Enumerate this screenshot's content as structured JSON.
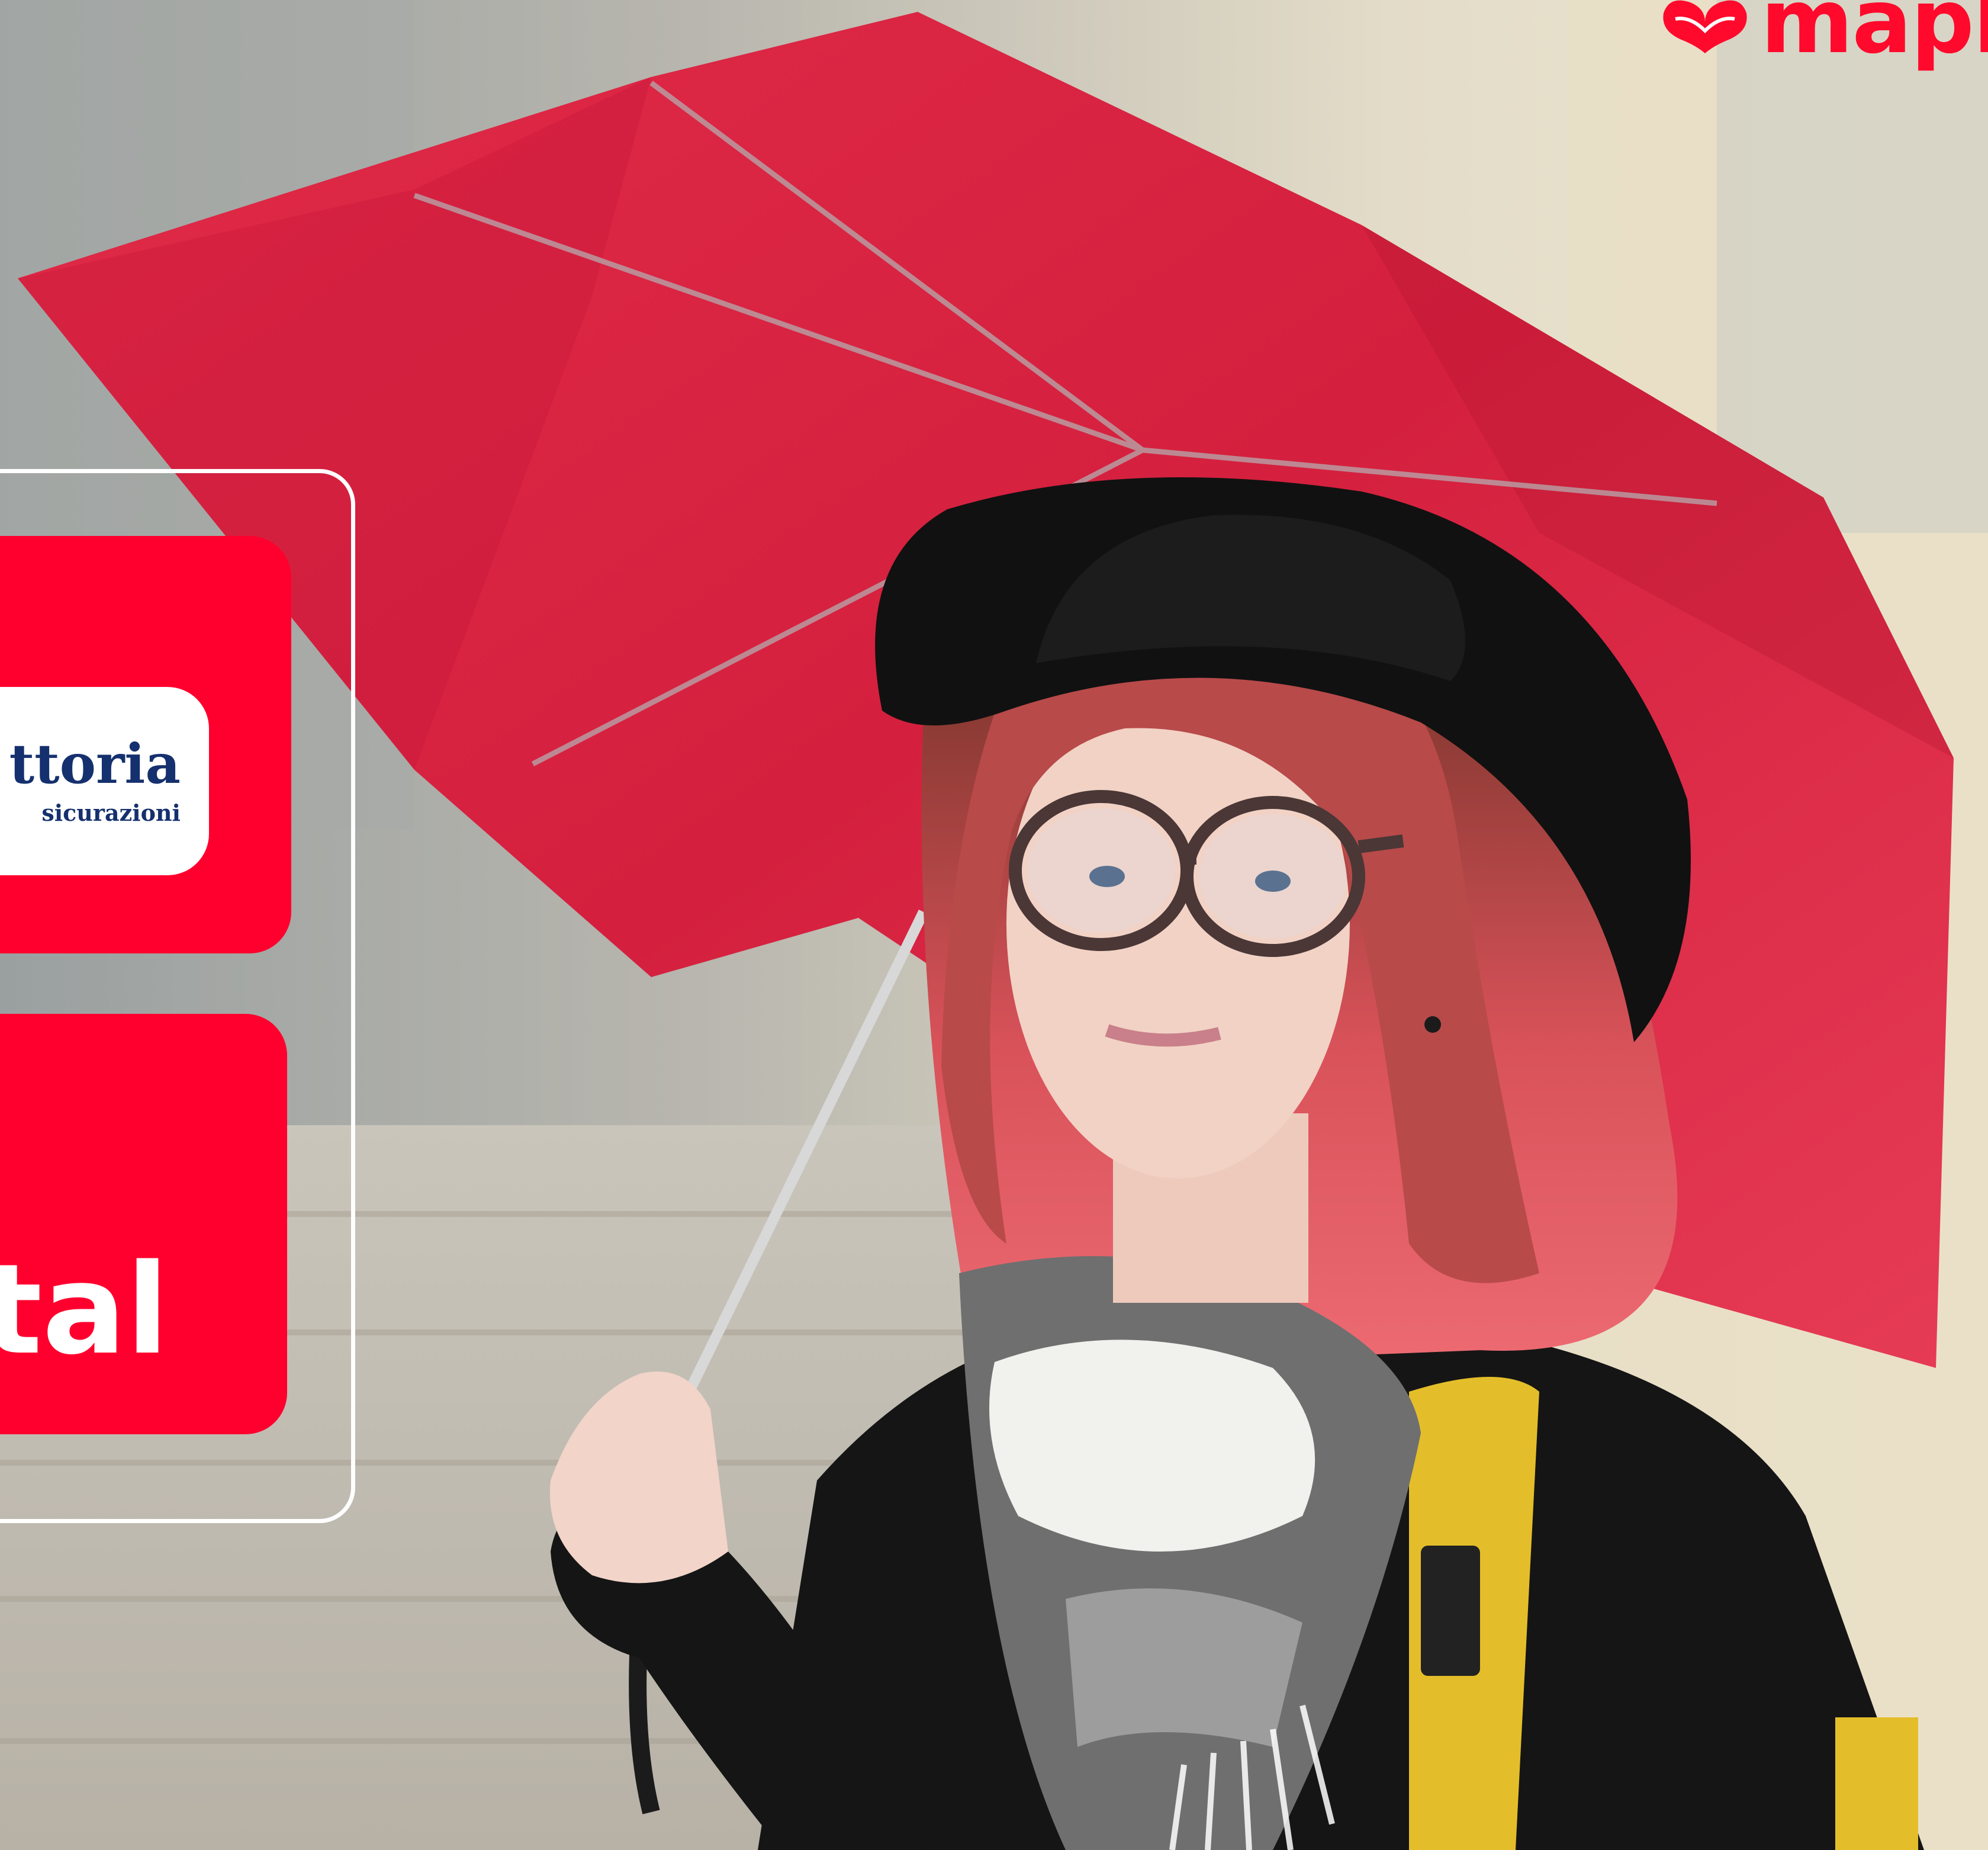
{
  "colors": {
    "brand_red": "#ff0a2c",
    "card_red": "#ff002e",
    "vittoria_blue": "#15306e",
    "panel_border": "#ffffff"
  },
  "brand": {
    "logo_text": "mapl",
    "icon": "heart-ribbon-icon"
  },
  "panel": {
    "card_1": {
      "badge_name": "ttoria",
      "badge_subtitle": "sicurazioni"
    },
    "card_2": {
      "word": "tal"
    }
  }
}
